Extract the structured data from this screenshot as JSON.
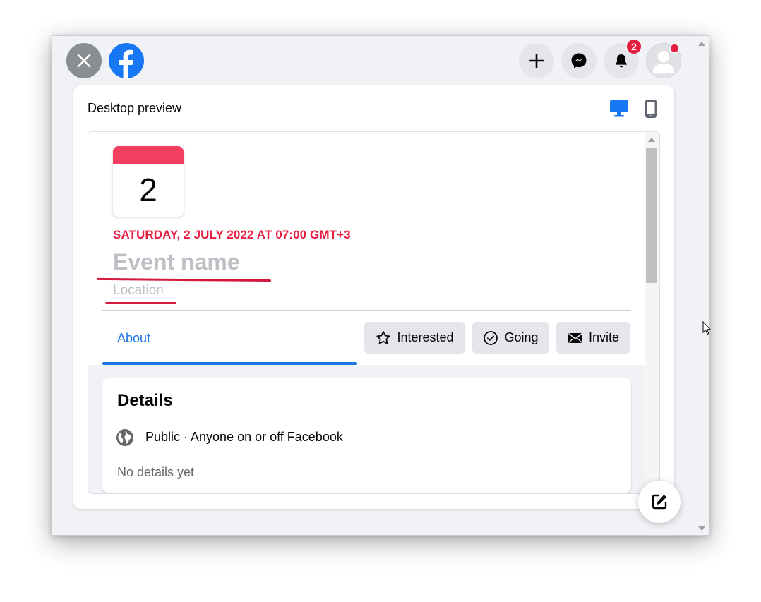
{
  "topbar": {
    "notification_count": "2"
  },
  "preview": {
    "title": "Desktop preview",
    "accent_color": "#1877f2"
  },
  "event": {
    "day": "2",
    "date_line": "SATURDAY, 2 JULY 2022 AT 07:00 GMT+3",
    "name_placeholder": "Event name",
    "location_placeholder": "Location"
  },
  "tabs": {
    "about": "About"
  },
  "actions": {
    "interested": "Interested",
    "going": "Going",
    "invite": "Invite"
  },
  "details": {
    "title": "Details",
    "privacy": "Public · Anyone on or off Facebook",
    "empty_text": "No details yet"
  },
  "icons": {
    "close": "close-icon",
    "facebook": "facebook-logo-icon",
    "add": "plus-icon",
    "messenger": "messenger-icon",
    "notifications": "bell-icon",
    "profile": "avatar-icon",
    "desktop": "desktop-icon",
    "mobile": "mobile-icon",
    "interested": "star-icon",
    "going": "check-circle-icon",
    "invite": "envelope-icon",
    "privacy": "globe-icon",
    "edit": "edit-icon"
  },
  "colors": {
    "brand": "#1877f2",
    "date_red": "#e41e3f",
    "annotation_red": "#d3193d",
    "calendar_red": "#f23f5f"
  }
}
